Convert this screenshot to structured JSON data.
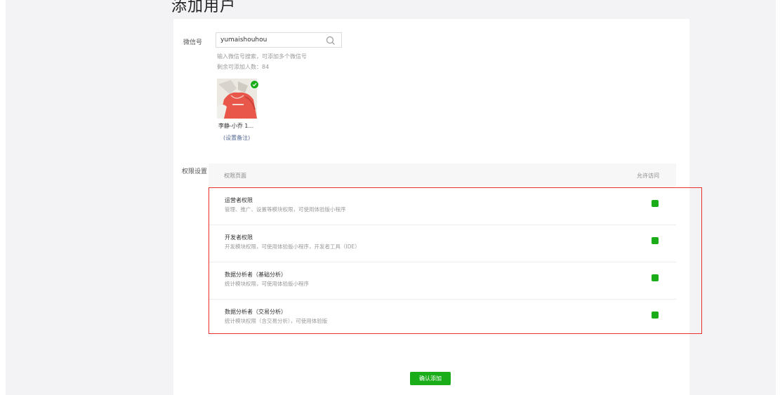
{
  "page": {
    "title": "添加用户"
  },
  "wechat": {
    "label": "微信号",
    "value": "yumaishouhou",
    "hint": "输入微信号搜索，可添加多个微信号",
    "remaining": "剩余可添加人数：84",
    "user_name": "李静-小乔 1...",
    "remark_link": "(设置备注)"
  },
  "permissions": {
    "label": "权限设置",
    "col_page": "权限页面",
    "col_allow": "允许访问",
    "rows": [
      {
        "title": "运营者权限",
        "desc": "管理、推广、设置等模块权限，可使用体验版小程序",
        "checked": true
      },
      {
        "title": "开发者权限",
        "desc": "开发模块权限，可使用体验版小程序，开发者工具（IDE）",
        "checked": true
      },
      {
        "title": "数据分析者（基础分析）",
        "desc": "统计模块权限，可使用体验版小程序",
        "checked": true
      },
      {
        "title": "数据分析者（交易分析）",
        "desc": "统计模块权限（含交易分析），可使用体验版",
        "checked": true
      }
    ]
  },
  "actions": {
    "confirm": "确认添加"
  },
  "colors": {
    "accent": "#1aad19",
    "highlight": "#e8302e",
    "link": "#576b95"
  },
  "icons": {
    "search": "search-icon",
    "check": "check-icon"
  }
}
